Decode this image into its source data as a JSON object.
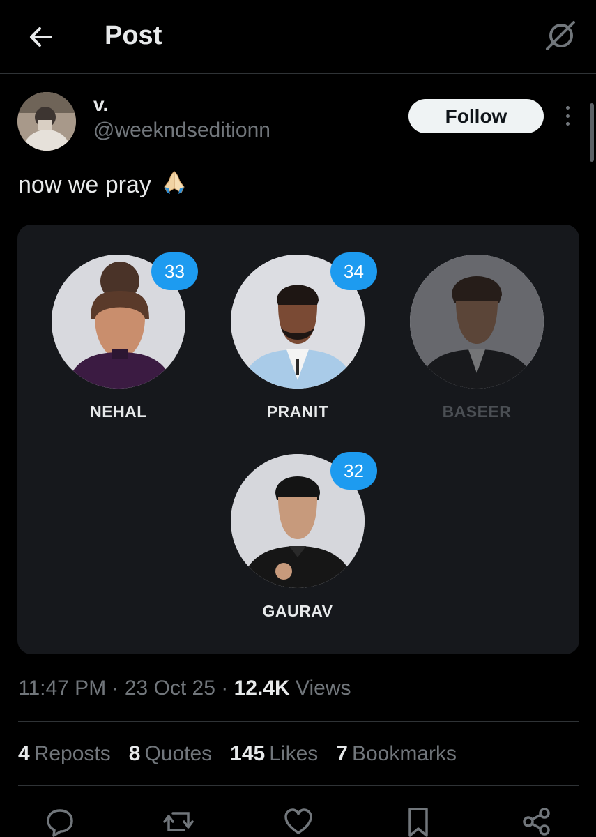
{
  "header": {
    "title": "Post",
    "back_icon": "arrow-left-icon",
    "grok_icon": "grok-icon"
  },
  "tweet": {
    "display_name": "v.",
    "handle": "@weekndseditionn",
    "follow_label": "Follow",
    "text": "now we pray",
    "emoji": "folded-hands",
    "timestamp": "11:47 PM · 23 Oct 25 · ",
    "views_count": "12.4K",
    "views_label": "Views"
  },
  "poll": {
    "candidates": [
      {
        "name": "NEHAL",
        "count": "33",
        "dimmed": false
      },
      {
        "name": "PRANIT",
        "count": "34",
        "dimmed": false
      },
      {
        "name": "BASEER",
        "count": "",
        "dimmed": true
      },
      {
        "name": "GAURAV",
        "count": "32",
        "dimmed": false
      }
    ]
  },
  "stats": {
    "reposts_count": "4",
    "reposts_label": "Reposts",
    "quotes_count": "8",
    "quotes_label": "Quotes",
    "likes_count": "145",
    "likes_label": "Likes",
    "bookmarks_count": "7",
    "bookmarks_label": "Bookmarks"
  },
  "colors": {
    "background": "#000000",
    "card": "#16181c",
    "accent": "#1d9bf0",
    "muted": "#71767b",
    "text": "#e7e9ea"
  }
}
